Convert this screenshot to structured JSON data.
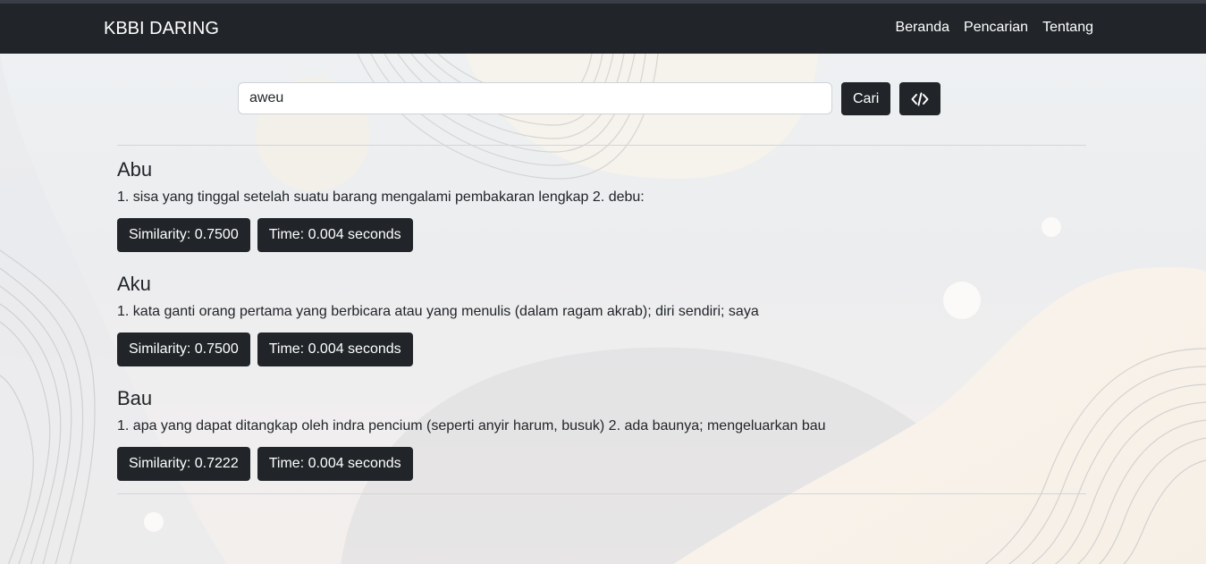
{
  "navbar": {
    "brand": "KBBI DARING",
    "links": [
      "Beranda",
      "Pencarian",
      "Tentang"
    ]
  },
  "search": {
    "value": "aweu",
    "button_label": "Cari",
    "code_icon": "code-icon"
  },
  "results": [
    {
      "word": "Abu",
      "definition": "1. sisa yang tinggal setelah suatu barang mengalami pembakaran lengkap 2. debu:",
      "similarity": "Similarity: 0.7500",
      "time": "Time: 0.004 seconds"
    },
    {
      "word": "Aku",
      "definition": "1. kata ganti orang pertama yang berbicara atau yang menulis (dalam ragam akrab); diri sendiri; saya",
      "similarity": "Similarity: 0.7500",
      "time": "Time: 0.004 seconds"
    },
    {
      "word": "Bau",
      "definition": "1. apa yang dapat ditangkap oleh indra pencium (seperti anyir harum, busuk) 2. ada baunya; mengeluarkan bau",
      "similarity": "Similarity: 0.7222",
      "time": "Time: 0.004 seconds"
    }
  ],
  "colors": {
    "navbar": "#212529",
    "button": "#212529"
  }
}
